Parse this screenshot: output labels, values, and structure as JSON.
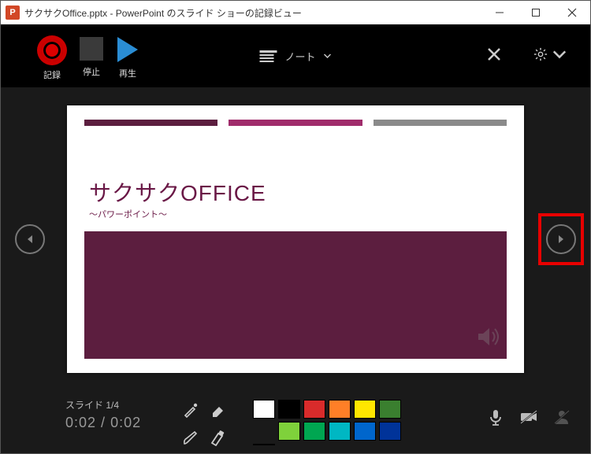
{
  "titlebar": {
    "app_badge": "P",
    "title": "サクサクOffice.pptx - PowerPoint のスライド ショーの記録ビュー"
  },
  "toolbar": {
    "record_label": "記録",
    "stop_label": "停止",
    "play_label": "再生",
    "notes_label": "ノート"
  },
  "slide": {
    "title": "サクサクOFFICE",
    "subtitle": "～パワーポイント～",
    "bar_colors": [
      "#5c1e3f",
      "#a02c6b",
      "#8a8a8a"
    ]
  },
  "status": {
    "slide_counter": "スライド 1/4",
    "time_elapsed": "0:02",
    "time_sep": " / ",
    "time_total": "0:02"
  },
  "palette": {
    "row1": [
      "#ffffff",
      "#000000",
      "#d92b2b",
      "#ff7f27",
      "#ffe600",
      "#3a7f2f",
      "#d9d9d9"
    ],
    "row2": [
      "#7fd13b",
      "#00a651",
      "#00b7c3",
      "#0066cc",
      "#003399",
      "#6b2fb3",
      "#d9d9d9"
    ]
  }
}
